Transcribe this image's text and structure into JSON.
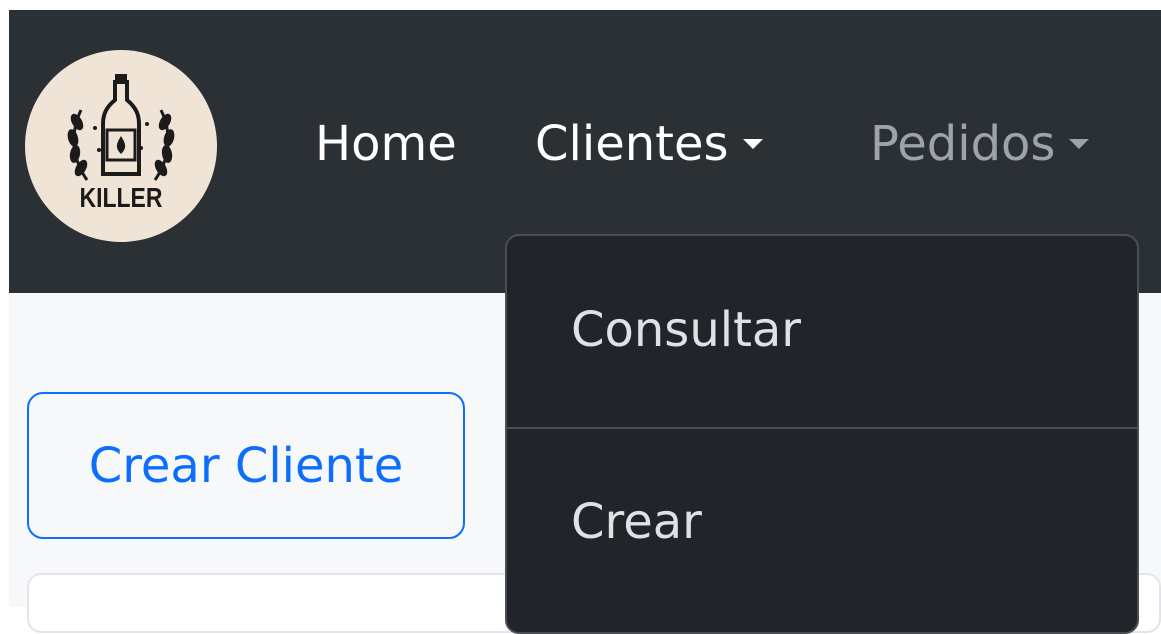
{
  "brand": {
    "logo_text": "KILLER",
    "logo_icon": "beer-bottle-wreath-icon",
    "logo_bg": "#efe4d6"
  },
  "nav": {
    "home_label": "Home",
    "clientes_label": "Clientes",
    "pedidos_label": "Pedidos"
  },
  "dropdown": {
    "items": [
      {
        "label": "Consultar"
      },
      {
        "label": "Crear"
      }
    ]
  },
  "main": {
    "create_button_label": "Crear Cliente"
  },
  "colors": {
    "navbar_bg": "#2b3035",
    "dropdown_bg": "#212529",
    "primary": "#0d6efd",
    "muted_link": "#9ea3a8"
  }
}
